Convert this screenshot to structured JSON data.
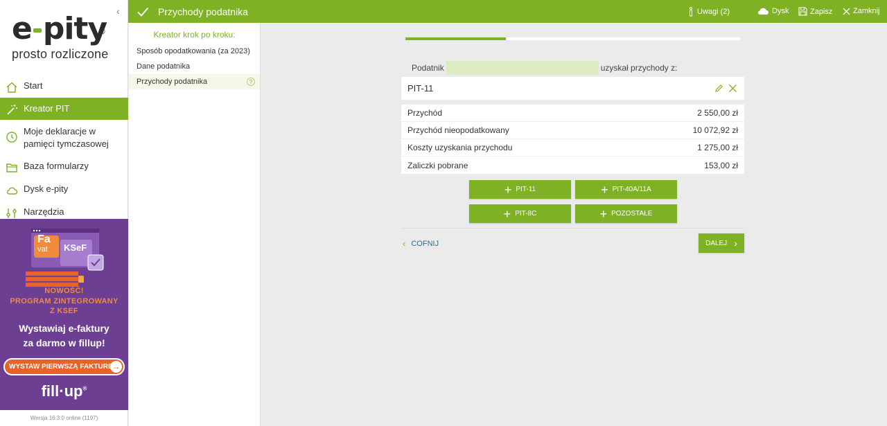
{
  "sidebar": {
    "collapse_icon": "chevron-left-icon",
    "logo": {
      "text_left": "e",
      "text_right": "pity",
      "reg": "®",
      "tagline": "prosto rozliczone"
    },
    "nav": [
      {
        "label": "Start",
        "icon": "home-icon",
        "active": false
      },
      {
        "label": "Kreator PIT",
        "icon": "magic-wand-icon",
        "active": true
      },
      {
        "label": "Moje deklaracje w pamięci tymczasowej",
        "icon": "clock-icon",
        "active": false
      },
      {
        "label": "Baza formularzy",
        "icon": "folder-icon",
        "active": false
      },
      {
        "label": "Dysk e-pity",
        "icon": "cloud-icon",
        "active": false
      },
      {
        "label": "Narzędzia",
        "icon": "tools-icon",
        "active": false
      }
    ],
    "banner": {
      "badge_fa": "Fa",
      "badge_vat": "vat",
      "badge_ksef": "KSeF",
      "new_line1": "NOWOŚĆ!",
      "new_line2": "PROGRAM ZINTEGROWANY",
      "new_line3": "Z KSEF",
      "main_line1": "Wystawiaj e-faktury",
      "main_line2": "za darmo w fillup!",
      "cta": "WYSTAW PIERWSZĄ FAKTURĘ",
      "brand": "fill·up",
      "brand_reg": "®"
    },
    "version": "Wersja 16.3.0 online (1197)"
  },
  "topbar": {
    "title": "Przychody podatnika",
    "actions": {
      "notes": "Uwagi (2)",
      "disk": "Dysk",
      "save": "Zapisz",
      "close": "Zamknij"
    }
  },
  "steps": {
    "title": "Kreator krok po kroku:",
    "items": [
      {
        "label": "Sposób opodatkowania (za 2023)",
        "active": false
      },
      {
        "label": "Dane podatnika",
        "active": false
      },
      {
        "label": "Przychody podatnika",
        "active": true,
        "help": "?"
      }
    ]
  },
  "main": {
    "progress_percent": 30,
    "intro_before": "Podatnik",
    "intro_after": "uzyskał przychody z:",
    "card": {
      "title": "PIT-11",
      "rows": [
        {
          "label": "Przychód",
          "value": "2 550,00 zł"
        },
        {
          "label": "Przychód nieopodatkowany",
          "value": "10 072,92 zł"
        },
        {
          "label": "Koszty uzyskania przychodu",
          "value": "1 275,00 zł"
        },
        {
          "label": "Zaliczki pobrane",
          "value": "153,00 zł"
        }
      ]
    },
    "add_buttons": {
      "pit11": "PIT-11",
      "pit40a": "PIT-40A/11A",
      "pit8c": "PIT-8C",
      "other": "POZOSTAŁE"
    },
    "back": "COFNIJ",
    "next": "DALEJ"
  },
  "colors": {
    "accent": "#7fb125",
    "banner": "#6c3f93",
    "cta": "#e8622c",
    "link": "#2a6e8c"
  }
}
